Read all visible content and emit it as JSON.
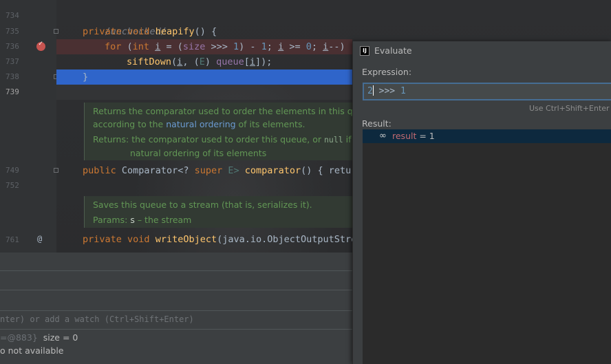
{
  "editor": {
    "line_numbers": [
      "734",
      "735",
      "736",
      "737",
      "738",
      "739",
      "749",
      "752",
      "761"
    ],
    "lines": {
      "l734": "/unchecked/",
      "l735_kw": "private void",
      "l735_fn": "heapify",
      "l735_rest": "() {",
      "l736_for": "for",
      "l736_a": " (",
      "l736_int": "int",
      "l736_i1": "i",
      "l736_b": " = (",
      "l736_size": "size",
      "l736_c": " >>> ",
      "l736_one1": "1",
      "l736_d": ") - ",
      "l736_one2": "1",
      "l736_e": "; ",
      "l736_i2": "i",
      "l736_f": " >= ",
      "l736_zero": "0",
      "l736_g": "; ",
      "l736_i3": "i",
      "l736_h": "--)",
      "l737_fn": "siftDown",
      "l737_a": "(",
      "l737_i": "i",
      "l737_b": ", (",
      "l737_e": "E",
      "l737_c": ") ",
      "l737_queue": "queue",
      "l737_d": "[",
      "l737_i2": "i",
      "l737_end": "]);",
      "l738": "}",
      "l749_kw": "public",
      "l749_type": "Comparator<?",
      "l749_super": "super",
      "l749_e": "E>",
      "l749_fn": "comparator",
      "l749_rest": "() { retur",
      "l761_kw": "private void",
      "l761_fn": "writeObject",
      "l761_rest": "(java.io.ObjectOutputStre"
    },
    "doc1": {
      "line1": "Returns the comparator used to order the elements in this qu",
      "line2_a": "according to the ",
      "line2_link": "natural ordering",
      "line2_b": " of its elements.",
      "returns_label": "Returns:",
      "returns_text": "the comparator used to order this queue, or",
      "returns_code": "null",
      "returns_tail": "if t",
      "returns_line2": "natural ordering of its elements"
    },
    "doc2": {
      "line1": "Saves this queue to a stream (that is, serializes it).",
      "params_label": "Params:",
      "params_name": "s",
      "params_text": "– the stream"
    }
  },
  "bottom_panel": {
    "watch_placeholder": "nter) or add a watch (Ctrl+Shift+Enter)",
    "var1_ref": "=@883}",
    "var1_text": "size = 0",
    "var2_text": "o not available"
  },
  "evaluate_dialog": {
    "logo_text": "IJ",
    "title": "Evaluate",
    "expression_label": "Expression:",
    "expression_first": "2",
    "expression_op": " >>> ",
    "expression_second": "1",
    "hint": "Use Ctrl+Shift+Enter to",
    "result_label": "Result:",
    "result_icon": "glasses-icon",
    "result_name": "result",
    "result_value": " = 1"
  },
  "colors": {
    "editor_bg": "#2b2b2b",
    "keyword": "#cc7832",
    "method": "#ffc66d",
    "number": "#6897bb",
    "selection": "#2f65ca",
    "result_selection": "#0d293e"
  }
}
